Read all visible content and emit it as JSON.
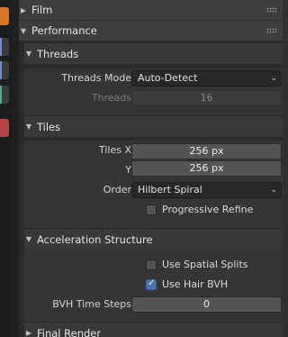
{
  "sections": {
    "film": "Film",
    "performance": "Performance",
    "final_render": "Final Render"
  },
  "threads": {
    "title": "Threads",
    "mode_label": "Threads Mode",
    "mode_value": "Auto-Detect",
    "threads_label": "Threads",
    "threads_value": "16"
  },
  "tiles": {
    "title": "Tiles",
    "x_label": "Tiles X",
    "x_value": "256 px",
    "y_label": "Y",
    "y_value": "256 px",
    "order_label": "Order",
    "order_value": "Hilbert Spiral",
    "progressive_refine": "Progressive Refine",
    "progressive_refine_checked": false
  },
  "acceleration": {
    "title": "Acceleration Structure",
    "spatial_splits": "Use Spatial Splits",
    "spatial_splits_checked": false,
    "hair_bvh": "Use Hair BVH",
    "hair_bvh_checked": true,
    "bvh_steps_label": "BVH Time Steps",
    "bvh_steps_value": "0"
  },
  "colors": {
    "accent": "#4772b3",
    "panel_bg": "#2b2b2b"
  },
  "icons": [
    "orange-object-icon",
    "blue-wrench-icon",
    "teal-physics-icon",
    "red-checker-icon"
  ]
}
